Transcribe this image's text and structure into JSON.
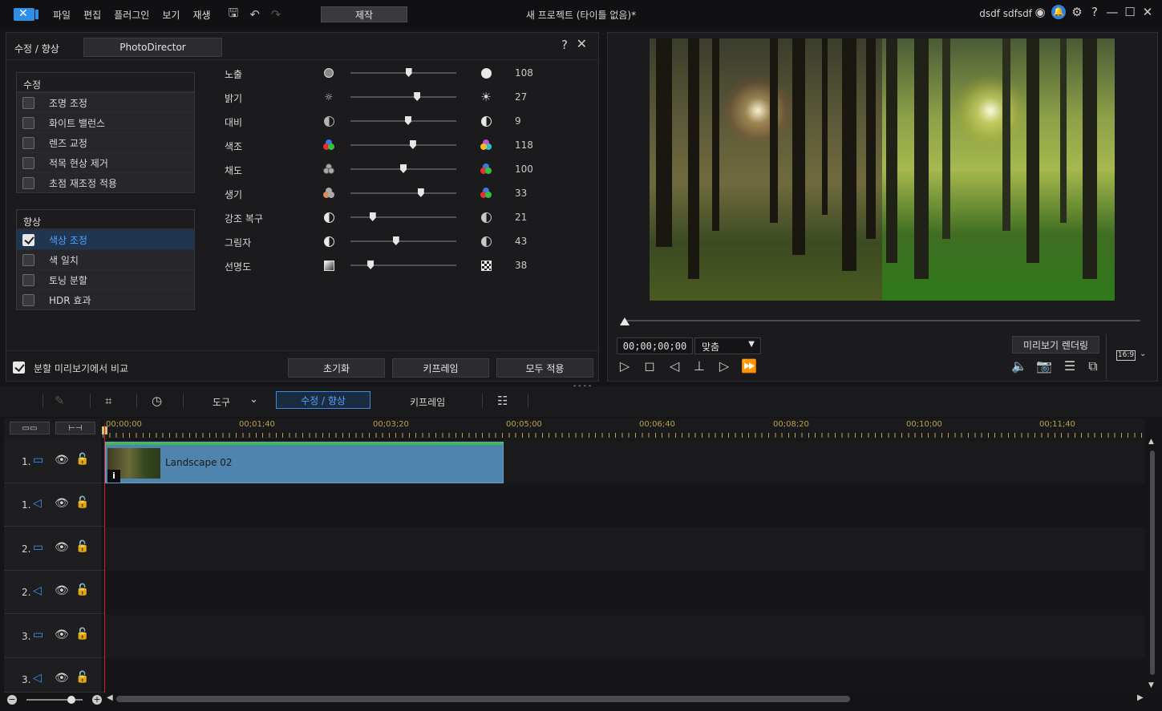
{
  "menubar": {
    "items": [
      "파일",
      "편집",
      "플러그인",
      "보기",
      "재생"
    ],
    "produce_label": "제작",
    "title": "새 프로젝트 (타이틀 없음)*",
    "user": "dsdf sdfsdf"
  },
  "adjust_panel": {
    "title": "수정 / 향상",
    "photodirector_label": "PhotoDirector",
    "fix_group": {
      "header": "수정",
      "items": [
        {
          "label": "조명 조정",
          "checked": false
        },
        {
          "label": "화이트 밸런스",
          "checked": false
        },
        {
          "label": "렌즈 교정",
          "checked": false
        },
        {
          "label": "적목 현상 제거",
          "checked": false
        },
        {
          "label": "초점 재조정 적용",
          "checked": false
        }
      ]
    },
    "enhance_group": {
      "header": "향상",
      "items": [
        {
          "label": "색상 조정",
          "checked": true,
          "selected": true
        },
        {
          "label": "색 일치",
          "checked": false
        },
        {
          "label": "토닝 분할",
          "checked": false
        },
        {
          "label": "HDR 효과",
          "checked": false
        }
      ]
    },
    "sliders": [
      {
        "label": "노출",
        "value": "108",
        "position": 0.55
      },
      {
        "label": "밝기",
        "value": "27",
        "position": 0.63
      },
      {
        "label": "대비",
        "value": "9",
        "position": 0.545
      },
      {
        "label": "색조",
        "value": "118",
        "position": 0.59
      },
      {
        "label": "채도",
        "value": "100",
        "position": 0.5
      },
      {
        "label": "생기",
        "value": "33",
        "position": 0.665
      },
      {
        "label": "강조 복구",
        "value": "21",
        "position": 0.21
      },
      {
        "label": "그림자",
        "value": "43",
        "position": 0.43
      },
      {
        "label": "선명도",
        "value": "38",
        "position": 0.19
      }
    ],
    "footer": {
      "split_compare_label": "분할 미리보기에서 비교",
      "reset_label": "초기화",
      "keyframe_label": "키프레임",
      "apply_all_label": "모두 적용"
    }
  },
  "preview": {
    "timecode": "00;00;00;00",
    "fit_label": "맞춤",
    "render_label": "미리보기 렌더링",
    "aspect_ratio": "16:9"
  },
  "timeline_toolbar": {
    "tools_label": "도구",
    "fix_enhance_label": "수정 / 향상",
    "keyframe_label": "키프레임"
  },
  "ruler": {
    "labels": [
      "00;00;00",
      "00;01;40",
      "00;03;20",
      "00;05;00",
      "00;06;40",
      "00;08;20",
      "00;10;00",
      "00;11;40"
    ]
  },
  "tracks": [
    {
      "num": "1.",
      "type": "video"
    },
    {
      "num": "1.",
      "type": "audio"
    },
    {
      "num": "2.",
      "type": "video"
    },
    {
      "num": "2.",
      "type": "audio"
    },
    {
      "num": "3.",
      "type": "video"
    },
    {
      "num": "3.",
      "type": "audio"
    }
  ],
  "clip": {
    "label": "Landscape 02",
    "info": "i"
  },
  "colors": {
    "accent": "#4da3ff",
    "clip": "#4e84ad",
    "playhead": "#d21e1e",
    "ruler": "#b8a24a"
  }
}
